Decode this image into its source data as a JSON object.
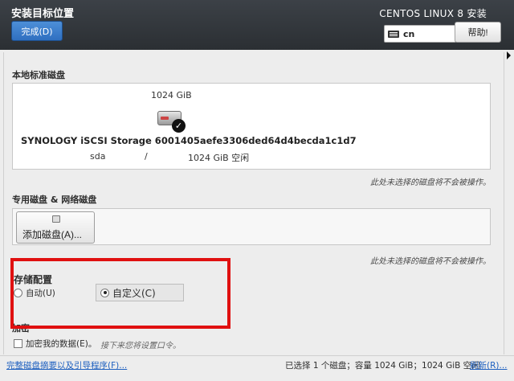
{
  "header": {
    "title": "安装目标位置",
    "done_label": "完成(D)",
    "product": "CENTOS LINUX 8 安装",
    "keyboard_layout": "cn",
    "help_label": "帮助!"
  },
  "local_disks": {
    "section_label": "本地标准磁盘",
    "disk": {
      "size": "1024 GiB",
      "name": "SYNOLOGY iSCSI Storage 6001405aefe3306ded64d4becda1c1d7",
      "device": "sda",
      "separator": "/",
      "free": "1024 GiB 空闲"
    },
    "hint": "此处未选择的磁盘将不会被操作。"
  },
  "network_disks": {
    "section_label": "专用磁盘 & 网络磁盘",
    "add_button_label": "添加磁盘(A)...",
    "hint": "此处未选择的磁盘将不会被操作。"
  },
  "storage_config": {
    "title": "存储配置",
    "options": [
      {
        "label": "自动(U)",
        "selected": false
      },
      {
        "label": "自定义(C)",
        "selected": true
      }
    ]
  },
  "encryption": {
    "title": "加密",
    "checkbox_label": "加密我的数据(E)。",
    "note": "接下来您将设置口令。"
  },
  "footer": {
    "summary_link": "完整磁盘摘要以及引导程序(F)...",
    "status": "已选择 1 个磁盘；容量 1024 GiB；1024 GiB 空闲",
    "refresh_link": "刷新(R)..."
  },
  "colors": {
    "header_bg": "#2f3338",
    "accent_blue": "#3a7bd0",
    "highlight_red": "#e01010",
    "link": "#1d5fbf"
  }
}
